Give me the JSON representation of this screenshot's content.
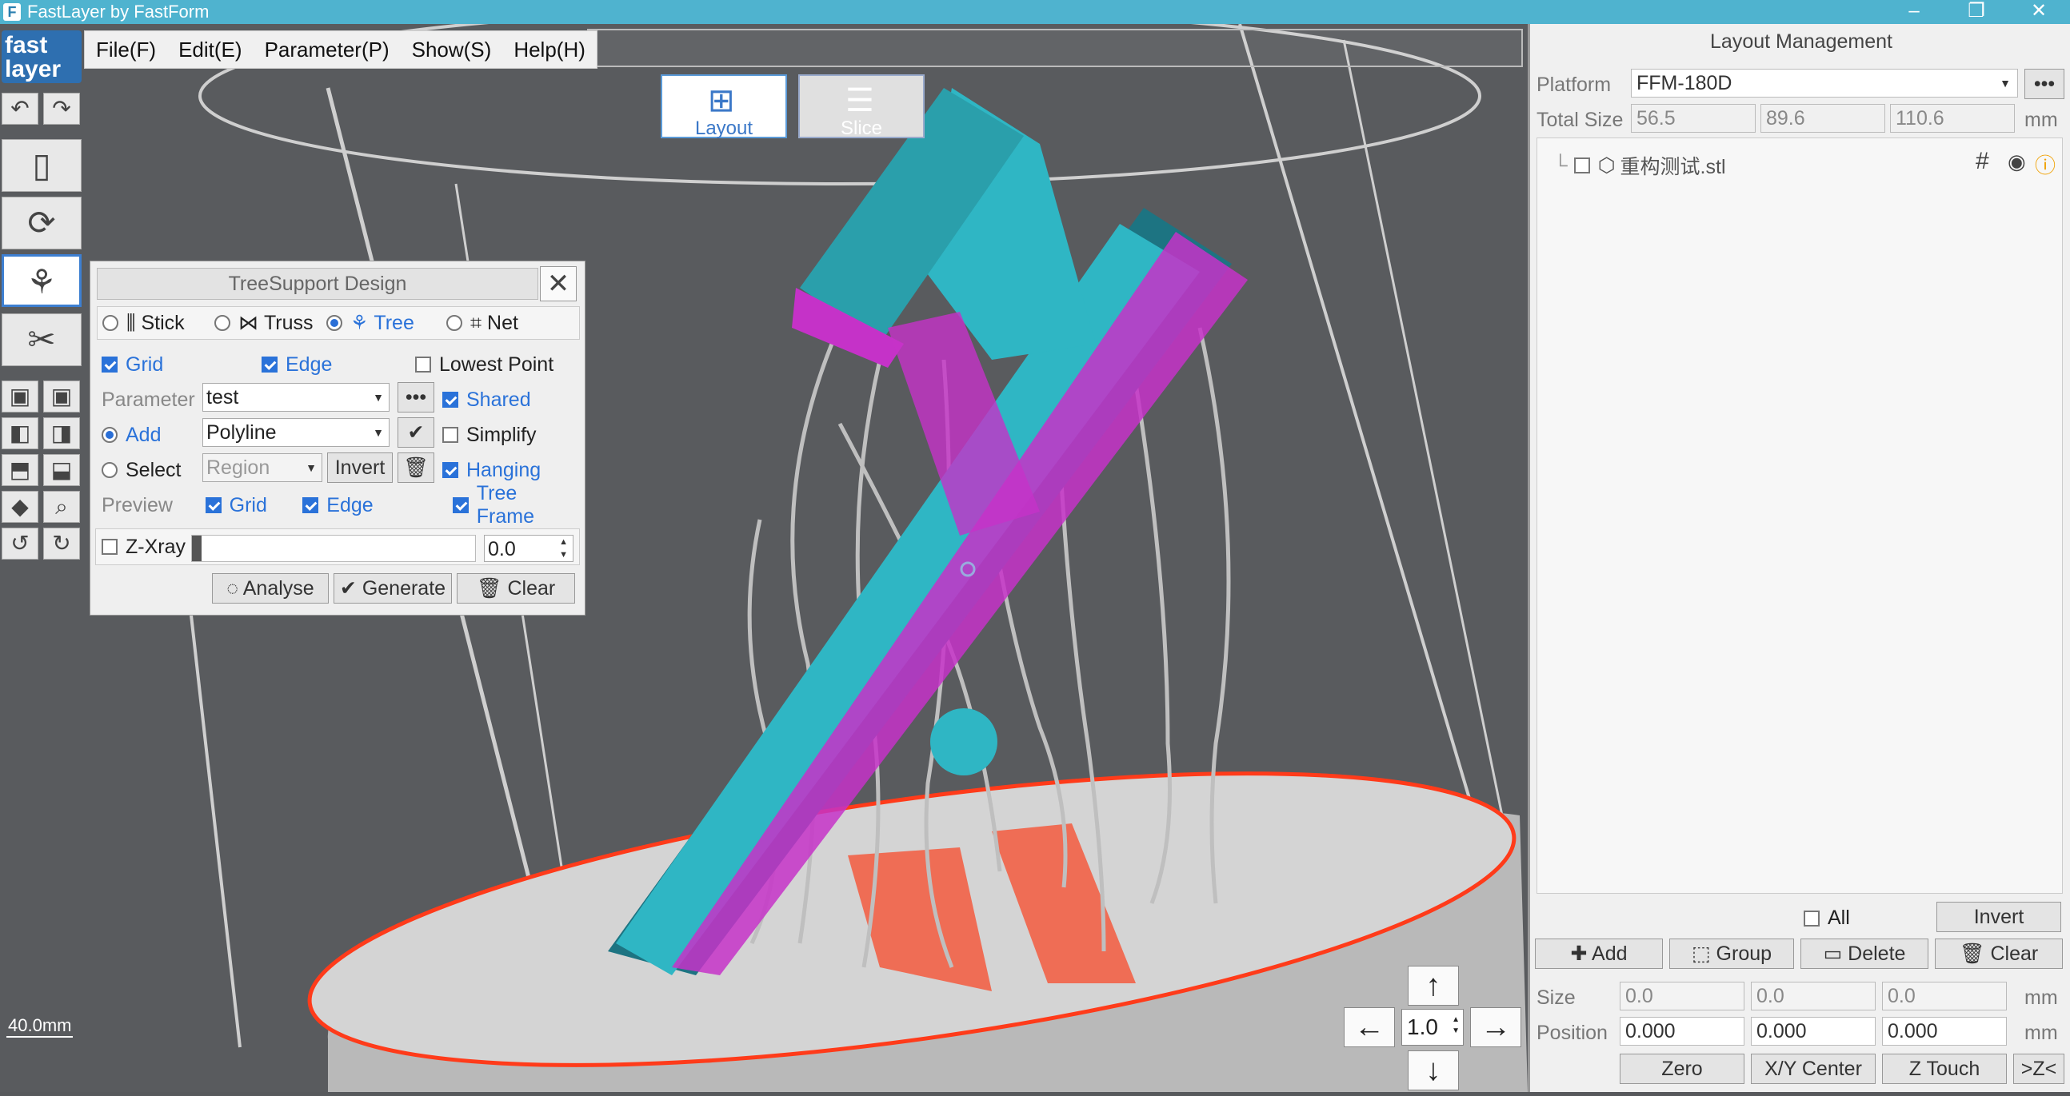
{
  "window": {
    "title": "FastLayer by FastForm",
    "controls": [
      "–",
      "❐",
      "✕"
    ]
  },
  "menu": [
    "File(F)",
    "Edit(E)",
    "Parameter(P)",
    "Show(S)",
    "Help(H)"
  ],
  "modes": {
    "layout": "Layout",
    "slice": "Slice"
  },
  "logo": {
    "text": "fast layer"
  },
  "tree_support": {
    "title": "TreeSupport Design",
    "types": [
      "Stick",
      "Truss",
      "Tree",
      "Net"
    ],
    "selected_type": "Tree",
    "grid_label": "Grid",
    "edge_label": "Edge",
    "lowest_point_label": "Lowest Point",
    "parameter_label": "Parameter",
    "parameter_value": "test",
    "more_label": "•••",
    "shared_label": "Shared",
    "add_label": "Add",
    "add_value": "Polyline",
    "simplify_label": "Simplify",
    "select_label": "Select",
    "select_value": "Region",
    "invert_label": "Invert",
    "hanging_label": "Hanging",
    "preview_label": "Preview",
    "preview_grid": "Grid",
    "preview_edge": "Edge",
    "tree_frame_label": "Tree Frame",
    "zxray_label": "Z-Xray",
    "zxray_value": "0.0",
    "analyse_label": "Analyse",
    "generate_label": "Generate",
    "clear_label": "Clear"
  },
  "layout_mgmt": {
    "title": "Layout Management",
    "platform_label": "Platform",
    "platform_value": "FFM-180D",
    "total_size_label": "Total Size",
    "total_size": [
      "56.5",
      "89.6",
      "110.6"
    ],
    "unit": "mm",
    "file_name": "重构测试.stl",
    "all_label": "All",
    "invert_label": "Invert",
    "add_label": "Add",
    "group_label": "Group",
    "delete_label": "Delete",
    "clear_label": "Clear",
    "size_label": "Size",
    "size": [
      "0.0",
      "0.0",
      "0.0"
    ],
    "position_label": "Position",
    "position": [
      "0.000",
      "0.000",
      "0.000"
    ],
    "zero_label": "Zero",
    "xy_center_label": "X/Y Center",
    "z_touch_label": "Z Touch",
    "z_more_label": ">Z<"
  },
  "nav": {
    "step": "1.0"
  },
  "scale_bar": "40.0mm",
  "colors": {
    "titlebar": "#4fb3cf",
    "model": "#2fb6c4",
    "support": "#cc33cc",
    "platform_edge": "#ff4422"
  }
}
